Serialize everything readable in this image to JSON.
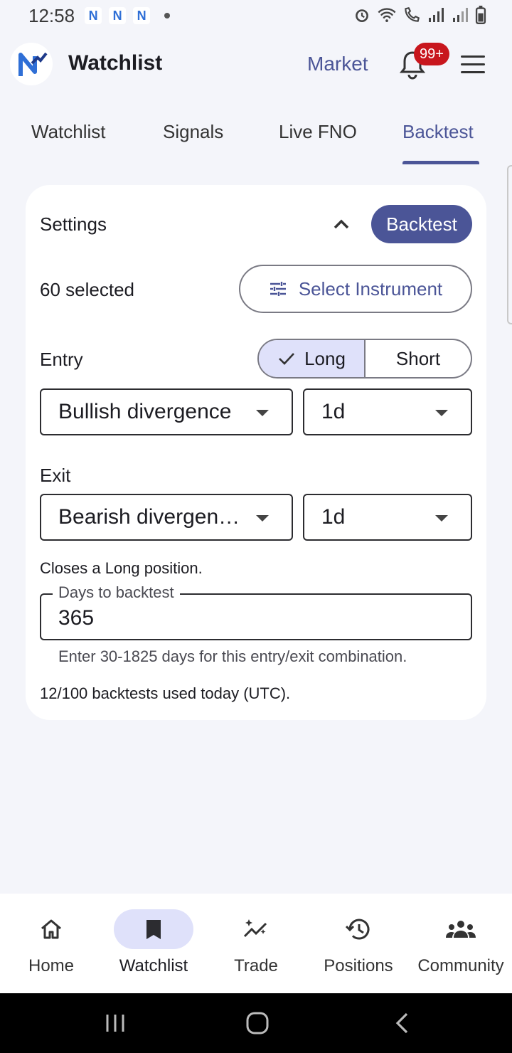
{
  "status_bar": {
    "time": "12:58"
  },
  "app_bar": {
    "title": "Watchlist",
    "market_label": "Market",
    "badge_count": "99+"
  },
  "tabs": [
    {
      "label": "Watchlist",
      "active": false
    },
    {
      "label": "Signals",
      "active": false
    },
    {
      "label": "Live FNO",
      "active": false
    },
    {
      "label": "Backtest",
      "active": true
    }
  ],
  "settings": {
    "title": "Settings",
    "backtest_button": "Backtest",
    "selected_count": "60 selected",
    "select_instrument": "Select Instrument",
    "entry_label": "Entry",
    "direction_options": [
      "Long",
      "Short"
    ],
    "direction_selected": "Long",
    "entry_signal": "Bullish divergence",
    "entry_timeframe": "1d",
    "exit_label": "Exit",
    "exit_signal": "Bearish divergen…",
    "exit_timeframe": "1d",
    "exit_note": "Closes a Long position.",
    "days_label": "Days to backtest",
    "days_value": "365",
    "days_helper": "Enter 30-1825 days for this entry/exit combination.",
    "usage": "12/100 backtests used today (UTC)."
  },
  "bottom_nav": [
    {
      "label": "Home",
      "icon": "home-icon",
      "active": false
    },
    {
      "label": "Watchlist",
      "icon": "bookmark-icon",
      "active": true
    },
    {
      "label": "Trade",
      "icon": "sparkle-chart-icon",
      "active": false
    },
    {
      "label": "Positions",
      "icon": "history-icon",
      "active": false
    },
    {
      "label": "Community",
      "icon": "people-icon",
      "active": false
    }
  ],
  "colors": {
    "accent": "#4b5597",
    "accent_light": "#dfe1fa",
    "badge": "#c8161d",
    "background": "#f4f5fa"
  }
}
